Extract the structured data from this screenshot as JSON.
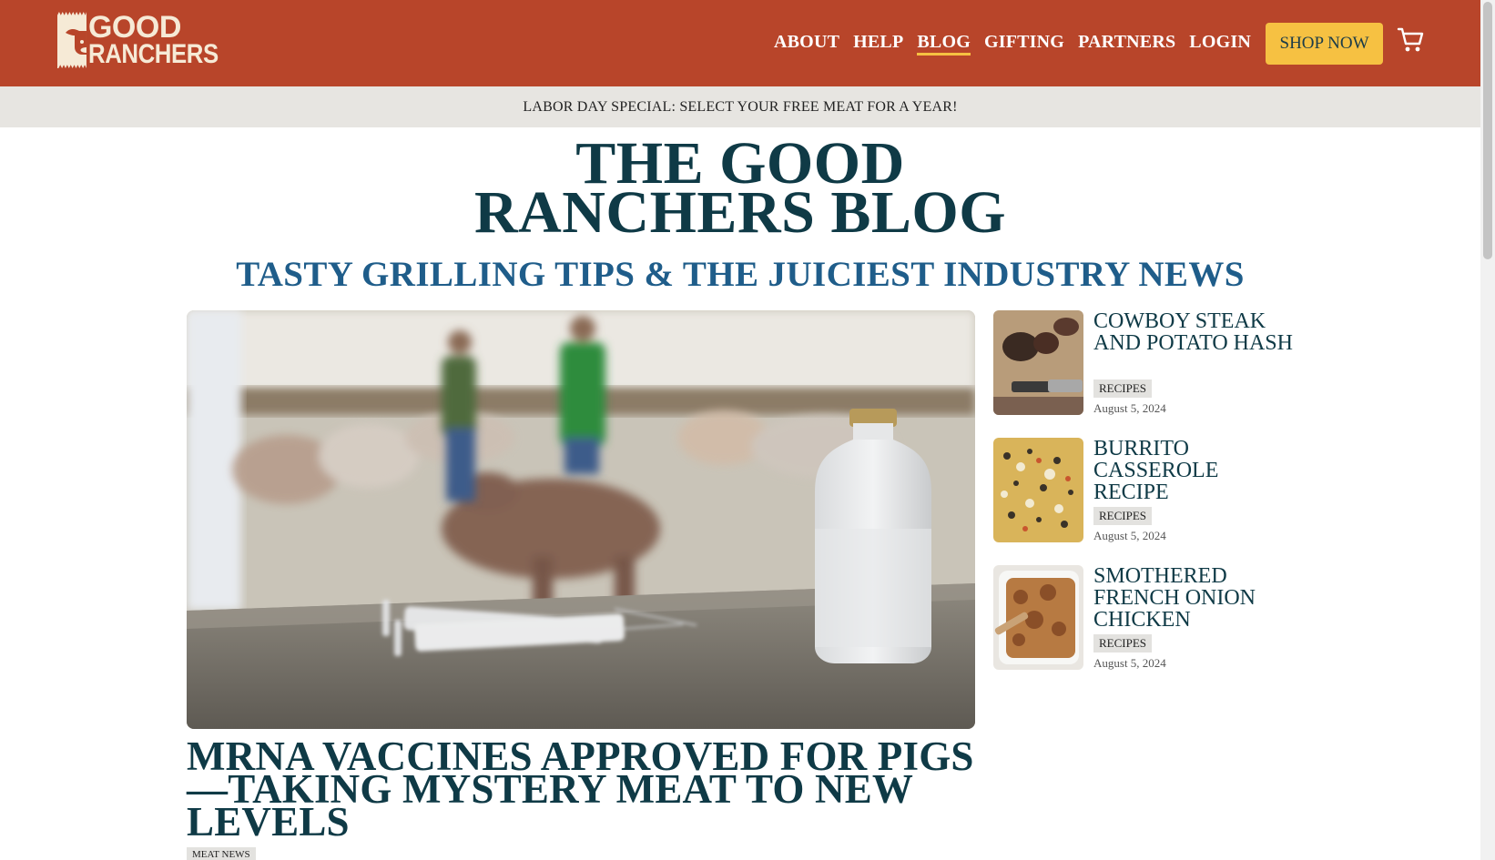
{
  "brand": {
    "logo_line1": "GOOD",
    "logo_line2": "RANCHERS",
    "primary_color": "#b8452a",
    "accent_color": "#f6c142"
  },
  "nav": {
    "items": [
      {
        "label": "ABOUT"
      },
      {
        "label": "HELP"
      },
      {
        "label": "BLOG",
        "active": true
      },
      {
        "label": "GIFTING"
      },
      {
        "label": "PARTNERS"
      },
      {
        "label": "LOGIN"
      }
    ],
    "cta": "SHOP NOW",
    "cart_icon": "cart-icon"
  },
  "promo": {
    "text": "LABOR DAY SPECIAL: SELECT YOUR FREE MEAT FOR A YEAR!"
  },
  "hero": {
    "title_line1": "THE GOOD",
    "title_line2": "RANCHERS BLOG",
    "subtitle": "TASTY GRILLING TIPS & THE JUICIEST INDUSTRY NEWS"
  },
  "featured": {
    "title": "MRNA VACCINES APPROVED FOR PIGS—TAKING MYSTERY MEAT TO NEW LEVELS",
    "tag": "MEAT NEWS"
  },
  "side_posts": [
    {
      "title": "COWBOY STEAK AND POTATO HASH",
      "tag": "RECIPES",
      "date": "August 5, 2024"
    },
    {
      "title": "BURRITO CASSEROLE RECIPE",
      "tag": "RECIPES",
      "date": "August 5, 2024"
    },
    {
      "title": "SMOTHERED FRENCH ONION CHICKEN",
      "tag": "RECIPES",
      "date": "August 5, 2024"
    }
  ]
}
